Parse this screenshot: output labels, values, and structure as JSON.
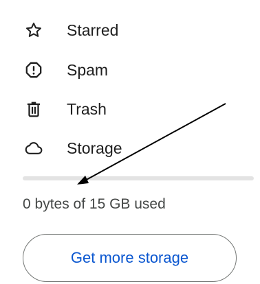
{
  "nav": {
    "items": [
      {
        "label": "Starred",
        "icon": "star-icon"
      },
      {
        "label": "Spam",
        "icon": "spam-icon"
      },
      {
        "label": "Trash",
        "icon": "trash-icon"
      },
      {
        "label": "Storage",
        "icon": "cloud-icon"
      }
    ]
  },
  "storage": {
    "usage_text": "0 bytes of 15 GB used",
    "used_fraction": 0,
    "button_label": "Get more storage",
    "bar_track_color": "#e3e3e3",
    "accent_color": "#0b57d0"
  }
}
